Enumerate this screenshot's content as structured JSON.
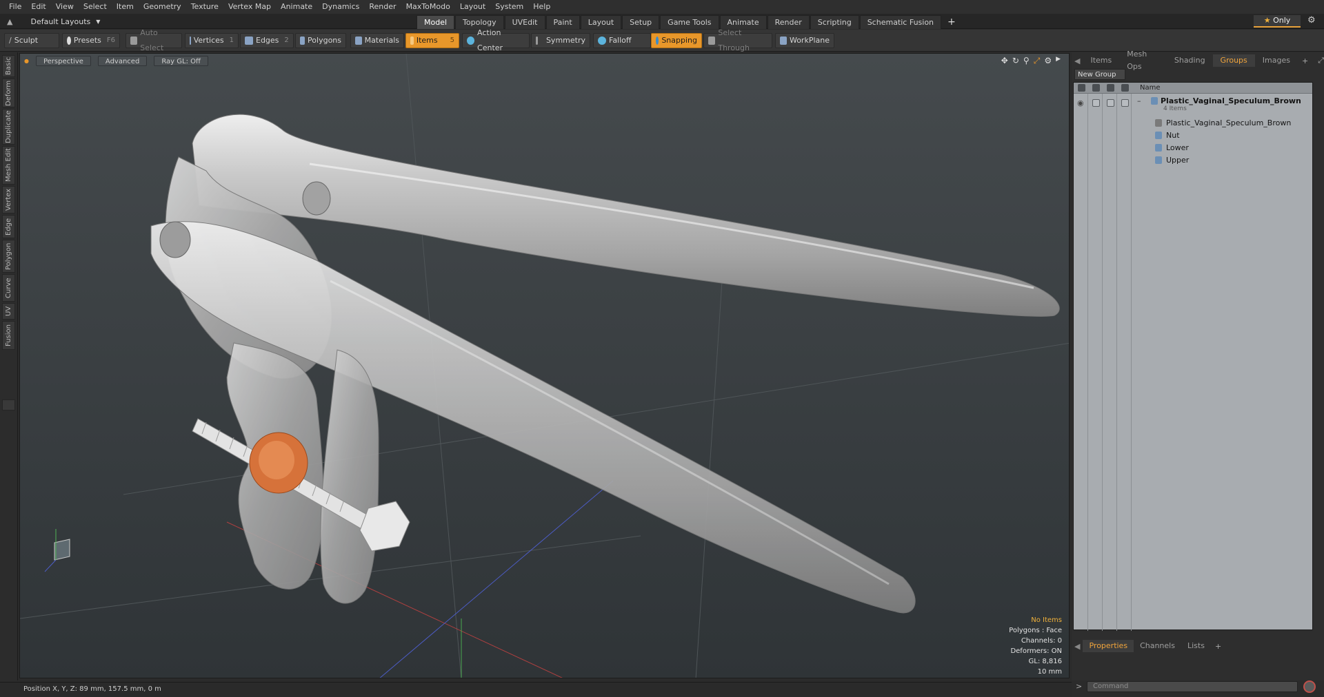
{
  "menu": [
    "File",
    "Edit",
    "View",
    "Select",
    "Item",
    "Geometry",
    "Texture",
    "Vertex Map",
    "Animate",
    "Dynamics",
    "Render",
    "MaxToModo",
    "Layout",
    "System",
    "Help"
  ],
  "layout_selector": "Default Layouts",
  "mode_tabs": [
    "Model",
    "Topology",
    "UVEdit",
    "Paint",
    "Layout",
    "Setup",
    "Game Tools",
    "Animate",
    "Render",
    "Scripting",
    "Schematic Fusion"
  ],
  "active_mode_tab": "Model",
  "only_button": "Only",
  "toolbar": {
    "sculpt": "Sculpt",
    "presets": "Presets",
    "presets_key": "F6",
    "auto_select": "Auto Select",
    "vertices": "Vertices",
    "vertices_key": "1",
    "edges": "Edges",
    "edges_key": "2",
    "polygons": "Polygons",
    "materials": "Materials",
    "items": "Items",
    "items_key": "5",
    "action_center": "Action Center",
    "symmetry": "Symmetry",
    "falloff": "Falloff",
    "snapping": "Snapping",
    "select_through": "Select Through",
    "workplane": "WorkPlane"
  },
  "left_tabs": [
    "Basic",
    "Deform",
    "Duplicate",
    "Mesh Edit",
    "Vertex",
    "Edge",
    "Polygon",
    "Curve",
    "UV",
    "Fusion"
  ],
  "viewport": {
    "view": "Perspective",
    "shading": "Advanced",
    "raygl": "Ray GL: Off",
    "info": {
      "selection": "No Items",
      "polygons": "Polygons : Face",
      "channels": "Channels: 0",
      "deformers": "Deformers: ON",
      "gl": "GL: 8,816",
      "scale": "10 mm"
    }
  },
  "right_panel": {
    "tabs": [
      "Items",
      "Mesh Ops",
      "Shading",
      "Groups",
      "Images"
    ],
    "active_tab": "Groups",
    "new_group": "New Group",
    "column_name": "Name",
    "group": {
      "name": "Plastic_Vaginal_Speculum_Brown",
      "count": "4 Items"
    },
    "children": [
      "Plastic_Vaginal_Speculum_Brown",
      "Nut",
      "Lower",
      "Upper"
    ],
    "bottom_tabs": [
      "Properties",
      "Channels",
      "Lists"
    ],
    "active_bottom_tab": "Properties",
    "command_placeholder": "Command"
  },
  "status": "Position X, Y, Z:  89 mm, 157.5 mm, 0 m",
  "colors": {
    "accent": "#e8972a",
    "viewport_bg": "#3a3f42",
    "nut": "#d6723a"
  }
}
